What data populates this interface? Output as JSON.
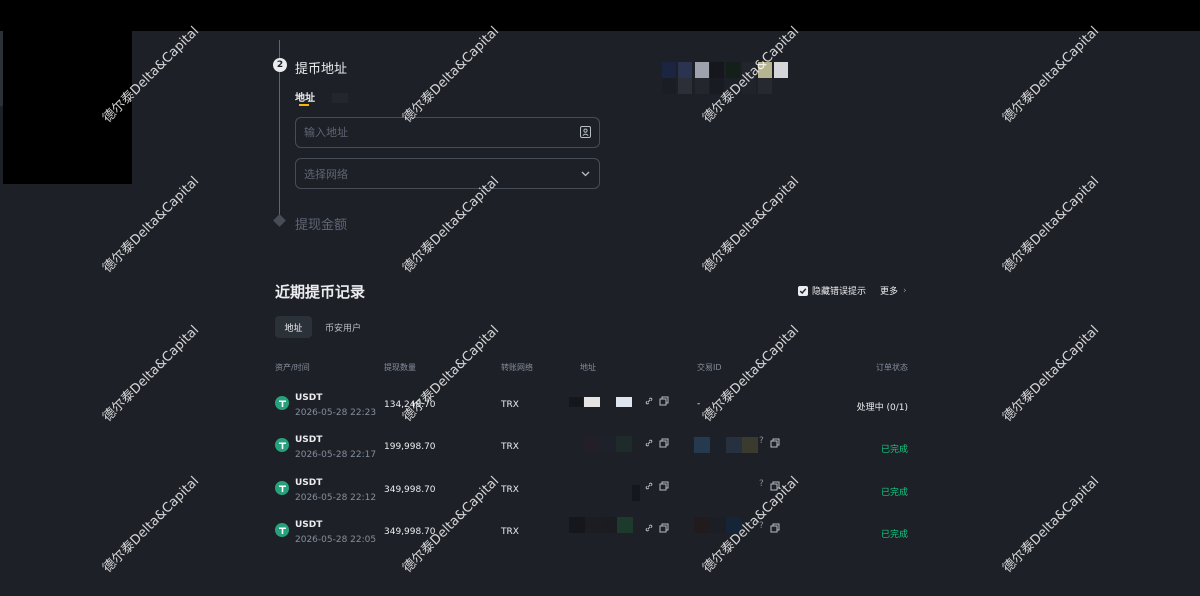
{
  "step_address": {
    "number": "2",
    "title": "提币地址"
  },
  "step_amount": {
    "title": "提现金额"
  },
  "address_tab": {
    "label": "地址"
  },
  "address_input": {
    "placeholder": "输入地址"
  },
  "network_select": {
    "placeholder": "选择网络"
  },
  "history": {
    "title": "近期提币记录",
    "hide_errors_label": "隐藏错误提示",
    "more_label": "更多",
    "tabs": [
      {
        "label": "地址"
      },
      {
        "label": "币安用户"
      }
    ],
    "columns": {
      "asset_time": "资产/时间",
      "amount": "提现数量",
      "network": "转账网络",
      "address": "地址",
      "txid": "交易ID",
      "status": "订单状态"
    },
    "rows": [
      {
        "coin": "USDT",
        "time": "2026-05-28 22:23",
        "amount": "134,248.70",
        "network": "TRX",
        "txid": "-",
        "status": "处理中 (0/1)"
      },
      {
        "coin": "USDT",
        "time": "2026-05-28 22:17",
        "amount": "199,998.70",
        "network": "TRX",
        "txid": "",
        "status": "已完成"
      },
      {
        "coin": "USDT",
        "time": "2026-05-28 22:12",
        "amount": "349,998.70",
        "network": "TRX",
        "txid": "",
        "status": "已完成"
      },
      {
        "coin": "USDT",
        "time": "2026-05-28 22:05",
        "amount": "349,998.70",
        "network": "TRX",
        "txid": "",
        "status": "已完成"
      }
    ]
  },
  "watermark": {
    "text": "德尔泰Delta&Capital"
  },
  "colors": {
    "background": "#1e2027",
    "accent": "#f0b90b",
    "success": "#0ecb81",
    "tether": "#26a17b"
  }
}
